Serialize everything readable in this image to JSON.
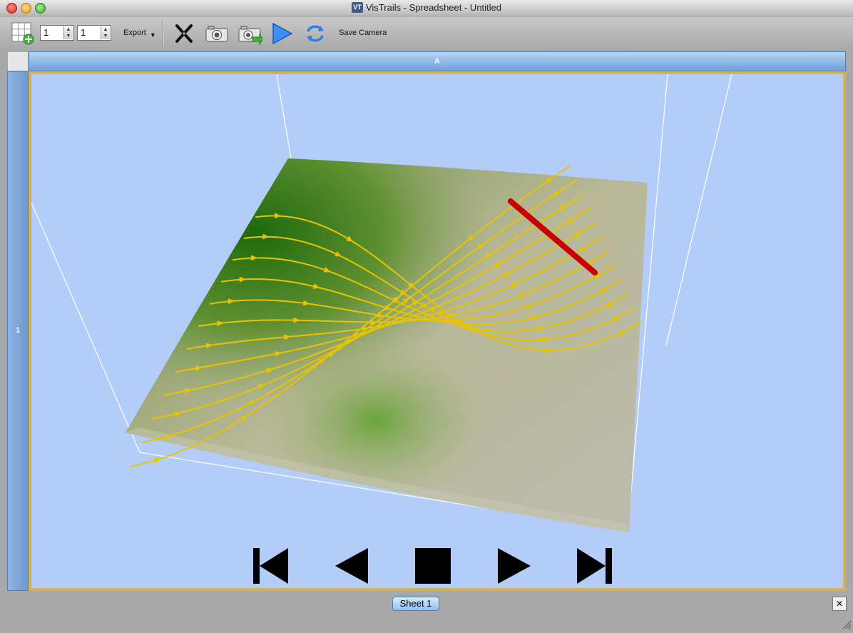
{
  "window": {
    "title": "VisTrails - Spreadsheet - Untitled",
    "app_icon_text": "VT"
  },
  "toolbar": {
    "rows_value": "1",
    "cols_value": "1",
    "export_label": "Export",
    "save_camera_label": "Save Camera"
  },
  "spreadsheet": {
    "column_header": "A",
    "row_header": "1"
  },
  "sheet_tabs": [
    {
      "label": "Sheet 1",
      "active": true
    }
  ],
  "colors": {
    "viewport_bg": "#b3cdf8",
    "cell_border": "#d4b25b",
    "header_blue": "#6fa0dc",
    "streamline": "#e8c400",
    "seed_line": "#c80000"
  },
  "icons": {
    "add_cell": "grid-plus-icon",
    "clear": "scissors-icon",
    "snapshot": "camera-icon",
    "snapshot_save": "camera-save-icon",
    "play": "play-icon",
    "sync": "sync-icon",
    "animation": [
      "skip-first-icon",
      "step-back-icon",
      "stop-icon",
      "step-forward-icon",
      "skip-last-icon"
    ]
  }
}
